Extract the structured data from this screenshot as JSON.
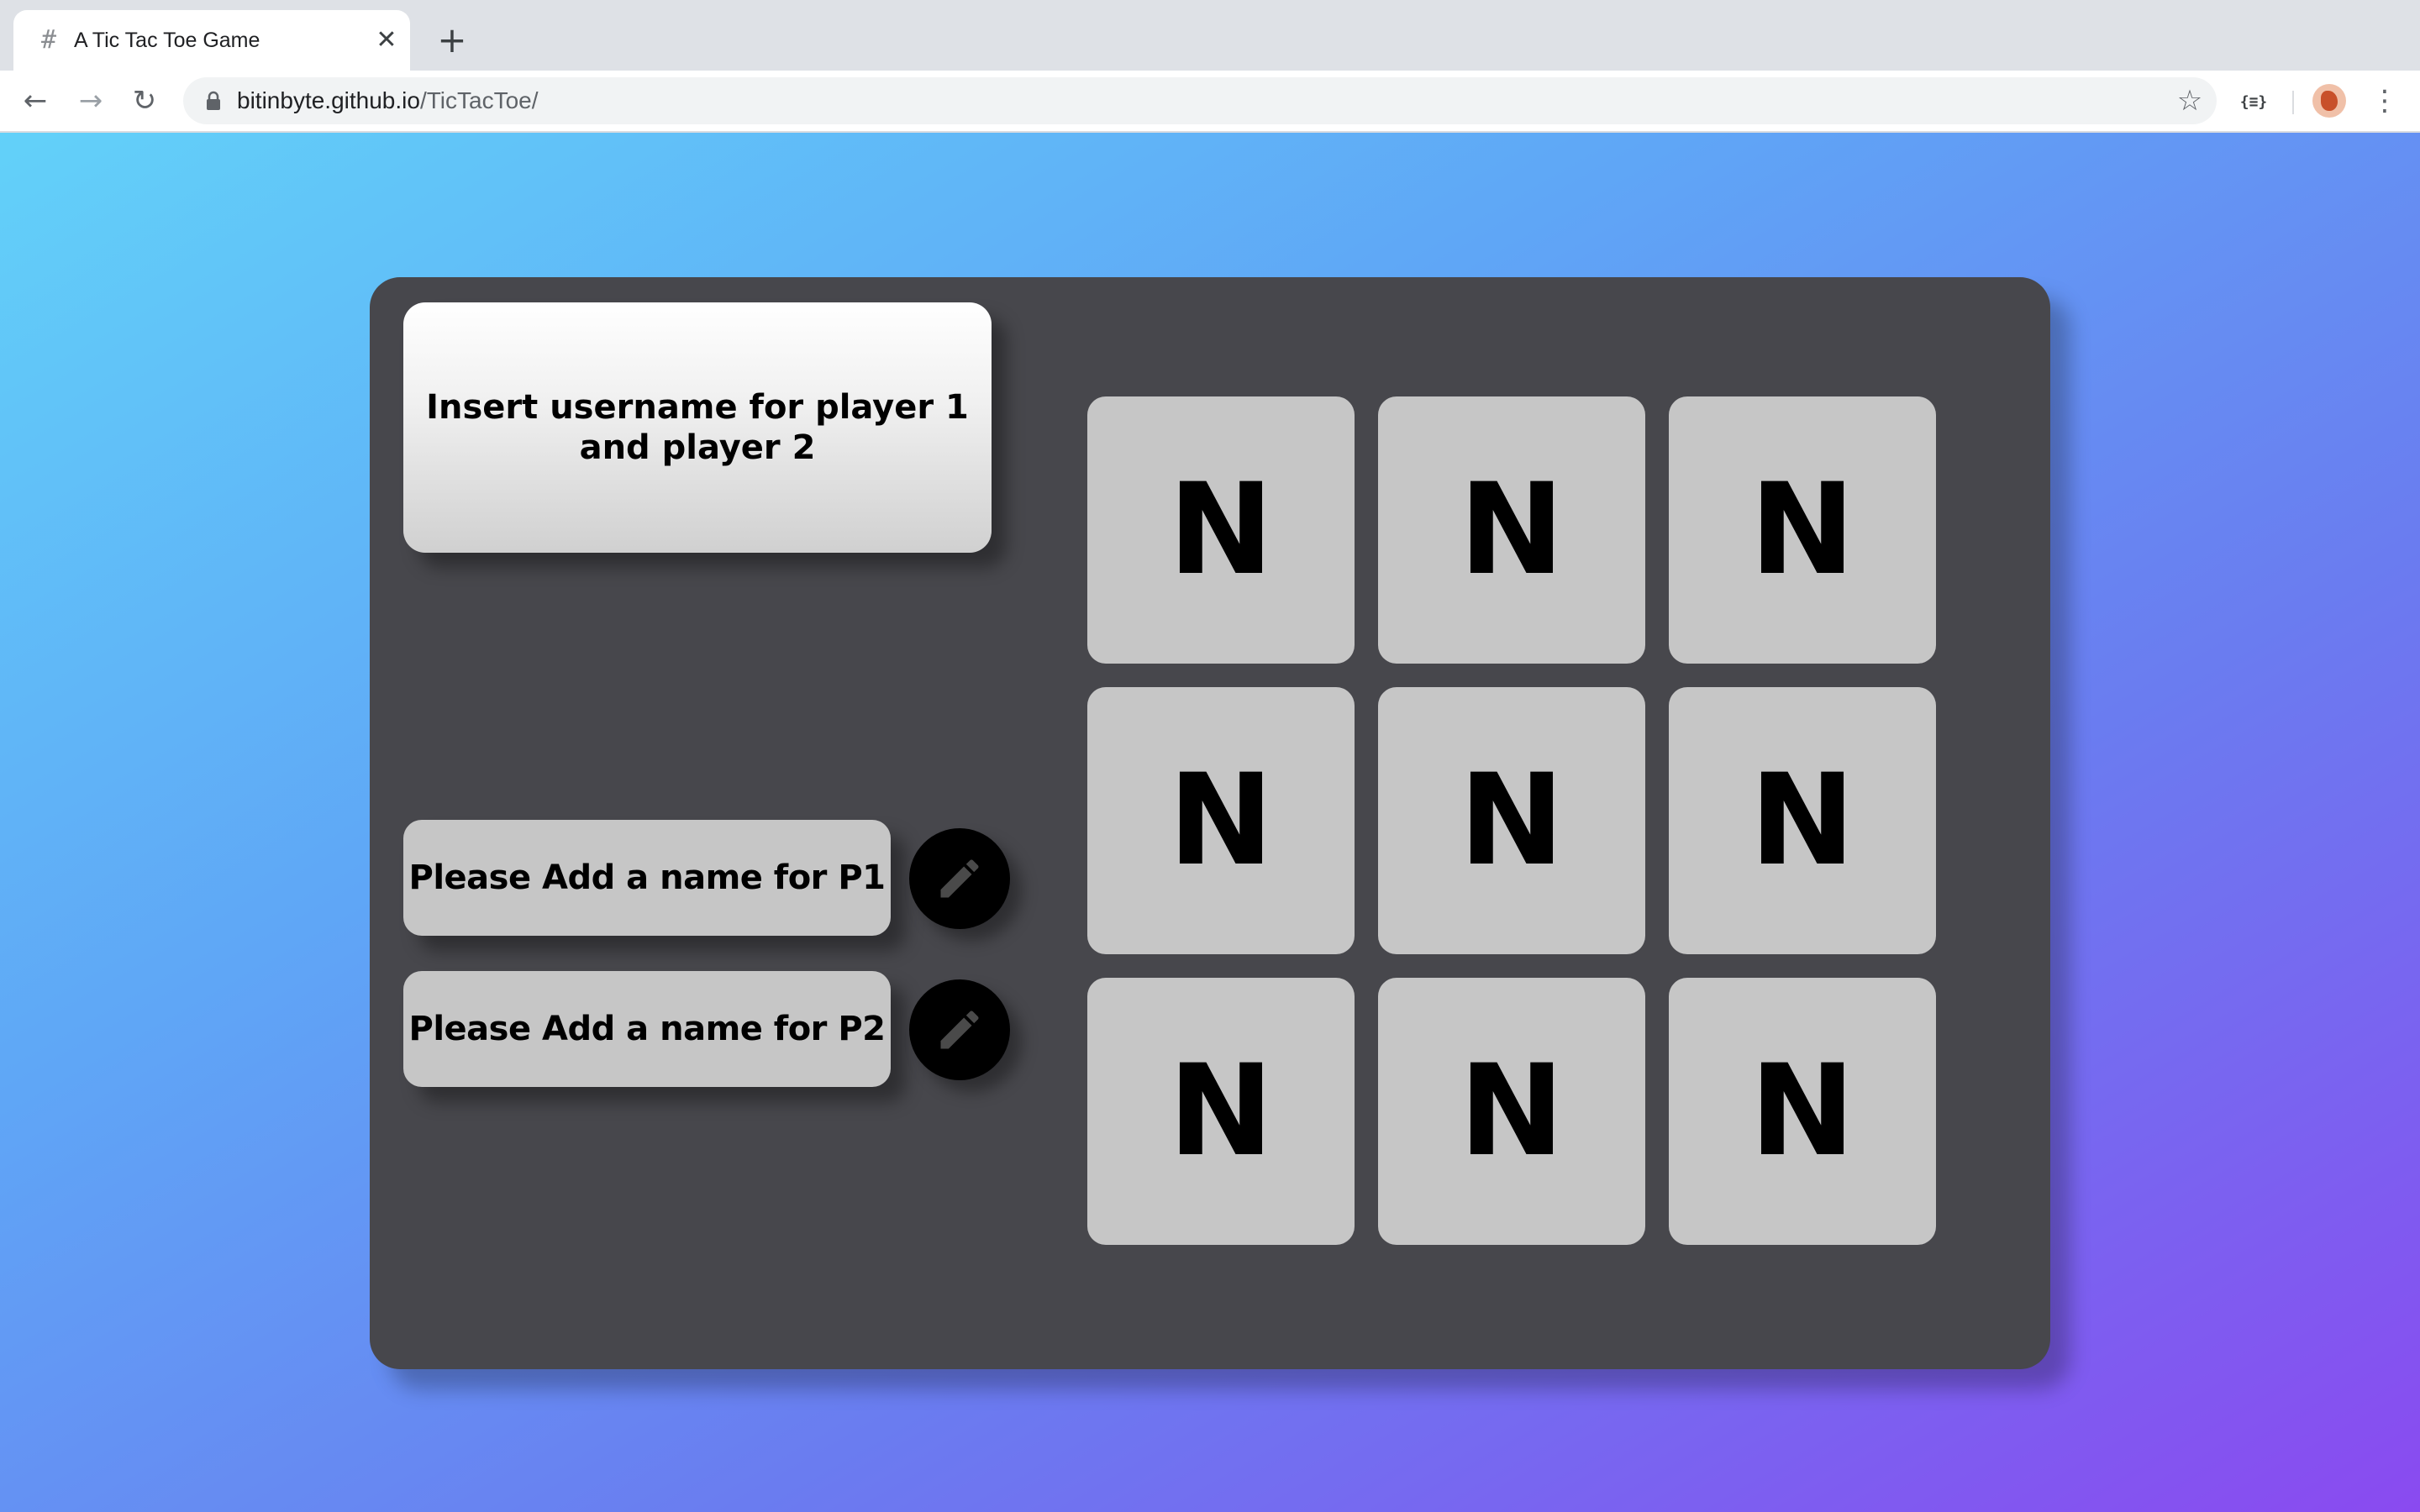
{
  "browser": {
    "tab_title": "A Tic Tac Toe Game",
    "tab_favicon": "hash-icon",
    "url_host": "bitinbyte.github.io",
    "url_path": "/TicTacToe/",
    "icons": {
      "back": "arrow-left-icon",
      "forward": "arrow-right-icon",
      "reload": "reload-icon",
      "lock": "lock-icon",
      "bookmark": "star-icon",
      "extension": "extension-icon",
      "menu": "kebab-menu-icon",
      "new_tab": "plus-icon",
      "close_tab": "close-icon"
    },
    "extension_label": "{≡}"
  },
  "game": {
    "instruction": "Insert username for player 1 and player 2",
    "player1_label": "Please Add a name for P1",
    "player2_label": "Please Add a name for P2",
    "edit_icon": "pencil-icon",
    "board": [
      [
        "N",
        "N",
        "N"
      ],
      [
        "N",
        "N",
        "N"
      ],
      [
        "N",
        "N",
        "N"
      ]
    ]
  },
  "colors": {
    "panel": "#47474c",
    "cell": "#c6c6c6",
    "gradient_start": "#62d1f9",
    "gradient_end": "#8a4af0"
  }
}
